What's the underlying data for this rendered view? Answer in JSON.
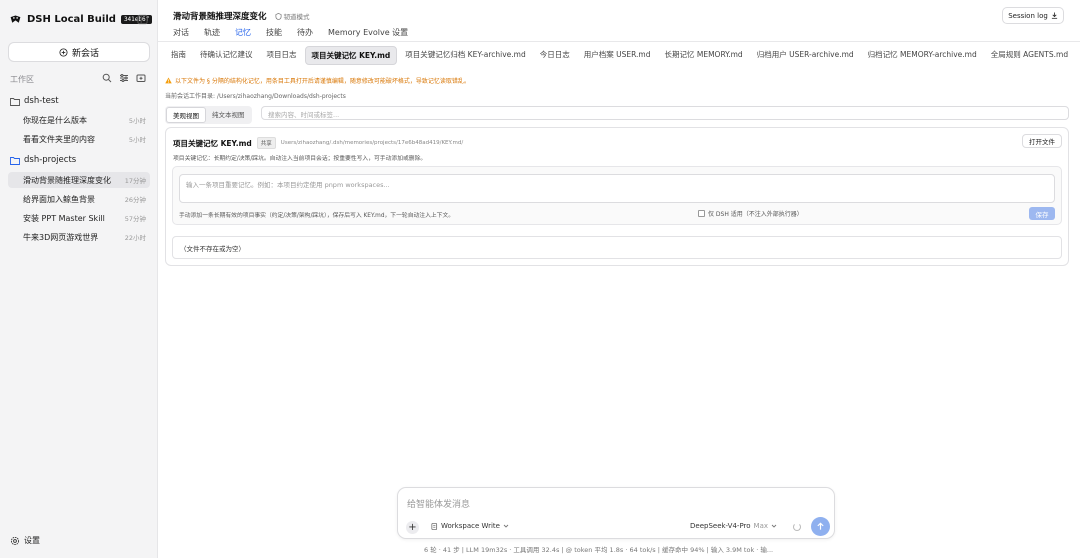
{
  "sidebar": {
    "brand": "DSH Local Build",
    "build_badge": "341eb6f",
    "new_chat": "新会话",
    "workspace_label": "工作区",
    "groups": [
      {
        "name": "dsh-test",
        "items": [
          {
            "title": "你现在是什么版本",
            "time": "5小时"
          },
          {
            "title": "看看文件夹里的内容",
            "time": "5小时"
          }
        ]
      },
      {
        "name": "dsh-projects",
        "items": [
          {
            "title": "滑动背景随推理深度变化",
            "time": "17分钟"
          },
          {
            "title": "给界面加入鲸鱼背景",
            "time": "26分钟"
          },
          {
            "title": "安装 PPT Master Skill",
            "time": "57分钟"
          },
          {
            "title": "牛来3D网页游戏世界",
            "time": "22小时"
          }
        ]
      }
    ],
    "settings": "设置"
  },
  "header": {
    "title": "滑动背景随推理深度变化",
    "mode": "韧道模式",
    "session_log": "Session log",
    "tabs": [
      "对话",
      "轨迹",
      "记忆",
      "技能",
      "待办",
      "Memory Evolve 设置"
    ],
    "active_tab": "记忆"
  },
  "file_tabs": {
    "items": [
      "指南",
      "待确认记忆建议",
      "项目日志",
      "项目关键记忆 KEY.md",
      "项目关键记忆归档 KEY-archive.md",
      "今日日志",
      "用户档案 USER.md",
      "长期记忆 MEMORY.md",
      "归档用户 USER-archive.md",
      "归档记忆 MEMORY-archive.md",
      "全局规则 AGENTS.md"
    ],
    "active": "项目关键记忆 KEY.md"
  },
  "warning": "以下文件为 § 分隔的结构化记忆，用条目工具打开后请谨慎编辑，随意修改可能破坏格式，导致记忆读取错乱。",
  "cwd": "当前会话工作目录: /Users/zihaozhang/Downloads/dsh-projects",
  "view": {
    "pretty": "美观视图",
    "raw": "纯文本视图",
    "search_placeholder": "搜索内容、时间或标签..."
  },
  "card": {
    "title": "项目关键记忆 KEY.md",
    "share_badge": "共享",
    "path": "Users/zihaozhang/.dsh/memories/projects/17e6b48ad419/KEY.md/",
    "open_file": "打开文件",
    "description": "项目关键记忆：长期约定/决策/踩坑。自动注入当前项目会话；按重要性写入，可手动添加或删除。",
    "input_placeholder": "输入一条项目重要记忆。例如：本项目约定使用 pnpm workspaces...",
    "hint": "手动添加一条长期有效的项目事实（约定/决策/架构/踩坑），保存后写入 KEY.md，下一轮自动注入上下文。",
    "only_dsh": "仅 DSH 适用（不注入外部执行器）",
    "save": "保存",
    "empty": "（文件不存在或为空）"
  },
  "composer": {
    "placeholder": "给智能体发消息",
    "workspace_mode": "Workspace Write",
    "model": "DeepSeek-V4-Pro",
    "model_tier": "Max"
  },
  "status_bar": "6 轮 · 41 步  |  LLM 19m32s · 工具调用 32.4s  |  @ token 平均 1.8s · 64 tok/s  |  缓存命中 94%  |  输入 3.9M tok · 输..."
}
